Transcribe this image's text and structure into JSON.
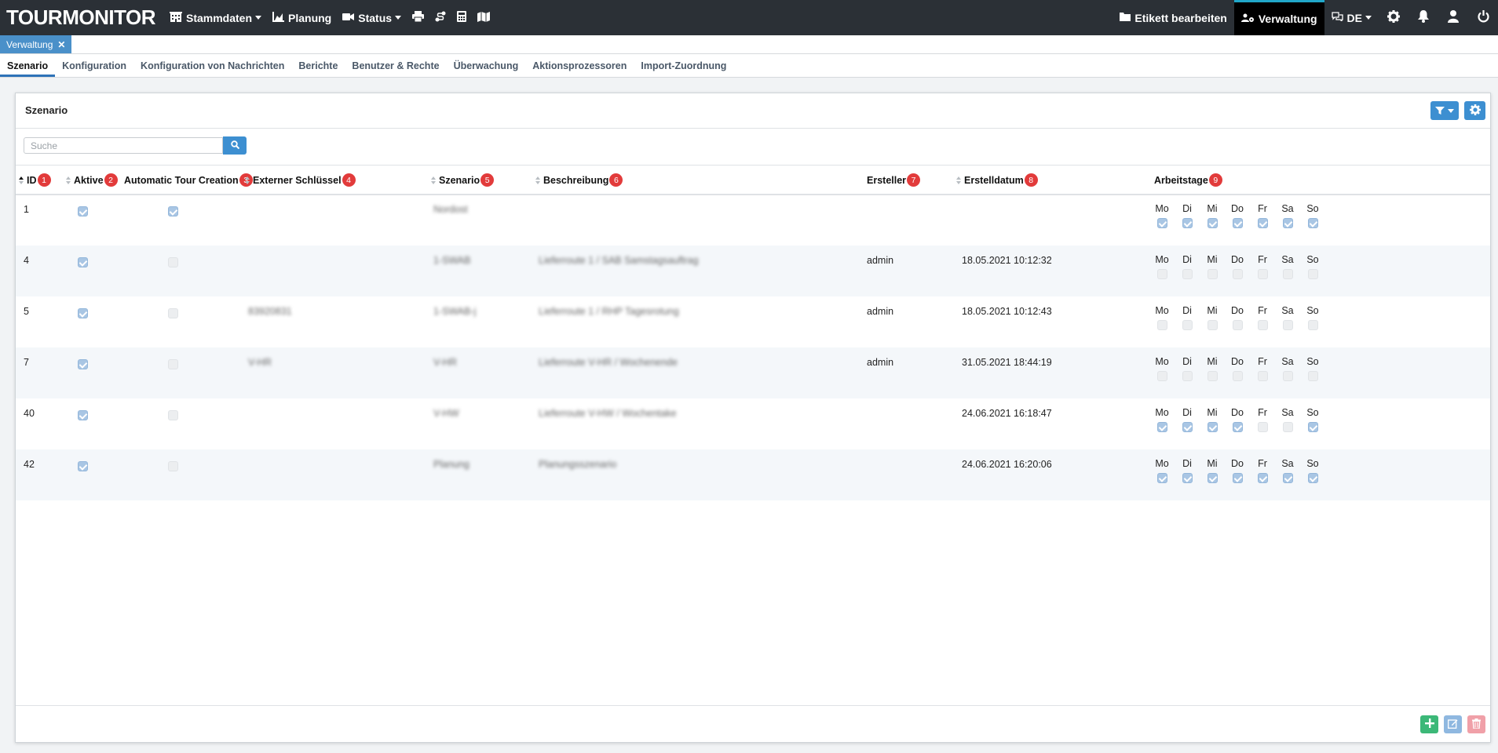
{
  "app": {
    "logo": "TOURMONITOR"
  },
  "nav": {
    "stammdaten": "Stammdaten",
    "planung": "Planung",
    "status": "Status",
    "etikett": "Etikett bearbeiten",
    "verwaltung": "Verwaltung",
    "language": "DE"
  },
  "doc_tab": {
    "label": "Verwaltung",
    "close": "✕"
  },
  "subnav": [
    "Szenario",
    "Konfiguration",
    "Konfiguration von Nachrichten",
    "Berichte",
    "Benutzer & Rechte",
    "Überwachung",
    "Aktionsprozessoren",
    "Import-Zuordnung"
  ],
  "panel": {
    "title": "Szenario"
  },
  "search": {
    "placeholder": "Suche"
  },
  "columns": [
    {
      "label": "ID",
      "badge": "1"
    },
    {
      "label": "Aktive",
      "badge": "2"
    },
    {
      "label": "Automatic Tour Creation",
      "badge": "3"
    },
    {
      "label": "Externer Schlüssel",
      "badge": "4"
    },
    {
      "label": "Szenario",
      "badge": "5"
    },
    {
      "label": "Beschreibung",
      "badge": "6"
    },
    {
      "label": "Ersteller",
      "badge": "7"
    },
    {
      "label": "Erstelldatum",
      "badge": "8"
    },
    {
      "label": "Arbeitstage",
      "badge": "9"
    }
  ],
  "day_labels": [
    "Mo",
    "Di",
    "Mi",
    "Do",
    "Fr",
    "Sa",
    "So"
  ],
  "rows": [
    {
      "id": "1",
      "aktive": true,
      "atc": true,
      "ext": "",
      "szenario": "Nordost",
      "beschreibung": "",
      "ersteller": "",
      "datum": "",
      "days": [
        true,
        true,
        true,
        true,
        true,
        true,
        true
      ]
    },
    {
      "id": "4",
      "aktive": true,
      "atc": false,
      "ext": "",
      "szenario": "1-SWAB",
      "beschreibung": "Lieferroute 1 / SAB Samstagsauftrag",
      "ersteller": "admin",
      "datum": "18.05.2021 10:12:32",
      "days": [
        false,
        false,
        false,
        false,
        false,
        false,
        false
      ]
    },
    {
      "id": "5",
      "aktive": true,
      "atc": false,
      "ext": "83920831",
      "szenario": "1-SWAB-j",
      "beschreibung": "Lieferroute 1 / RHP Tagesrotung",
      "ersteller": "admin",
      "datum": "18.05.2021 10:12:43",
      "days": [
        false,
        false,
        false,
        false,
        false,
        false,
        false
      ]
    },
    {
      "id": "7",
      "aktive": true,
      "atc": false,
      "ext": "V-HR",
      "szenario": "V-HR",
      "beschreibung": "Lieferroute V-HR / Wochenende",
      "ersteller": "admin",
      "datum": "31.05.2021 18:44:19",
      "days": [
        false,
        false,
        false,
        false,
        false,
        false,
        false
      ]
    },
    {
      "id": "40",
      "aktive": true,
      "atc": false,
      "ext": "",
      "szenario": "V-HW",
      "beschreibung": "Lieferroute V-HW / Wochentake",
      "ersteller": "",
      "datum": "24.06.2021 16:18:47",
      "days": [
        true,
        true,
        true,
        true,
        false,
        false,
        true
      ]
    },
    {
      "id": "42",
      "aktive": true,
      "atc": false,
      "ext": "",
      "szenario": "Planung",
      "beschreibung": "Planungsszenario",
      "ersteller": "",
      "datum": "24.06.2021 16:20:06",
      "days": [
        true,
        true,
        true,
        true,
        true,
        true,
        true
      ]
    }
  ],
  "colors": {
    "navbar": "#2b3036",
    "accent": "#3d8fd1",
    "badge": "#e23b3b",
    "add": "#3cb878",
    "edit": "#8fb8e0",
    "delete": "#f0a0a8"
  }
}
